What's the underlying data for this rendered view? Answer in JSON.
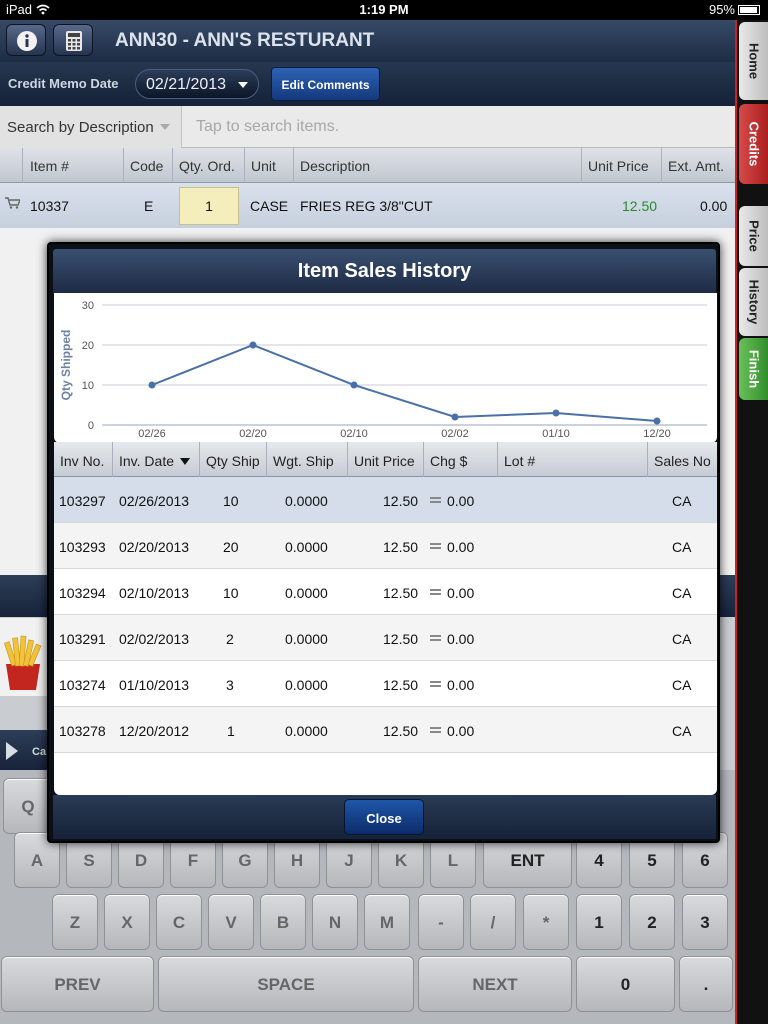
{
  "status_bar": {
    "carrier": "iPad",
    "time": "1:19 PM",
    "battery": "95%"
  },
  "header": {
    "title": "ANN30 - ANN'S RESTURANT",
    "info_icon": "info-icon",
    "calculator_icon": "calculator-icon"
  },
  "toolbar": {
    "memo_label": "Credit Memo Date",
    "memo_date": "02/21/2013",
    "edit_comments": "Edit Comments"
  },
  "search": {
    "mode": "Search by Description",
    "placeholder": "Tap to search items."
  },
  "order_columns": {
    "item": "Item #",
    "code": "Code",
    "qty": "Qty. Ord.",
    "unit": "Unit",
    "description": "Description",
    "unit_price": "Unit Price",
    "ext_amt": "Ext. Amt."
  },
  "order_row": {
    "item": "10337",
    "code": "E",
    "qty": "1",
    "unit": "CASE",
    "description": "FRIES REG 3/8\"CUT",
    "unit_price": "12.50",
    "ext_amt": "0.00",
    "price_color": "#2a8a2a"
  },
  "side_tabs": {
    "home": "Home",
    "credits": "Credits",
    "price": "Price",
    "history": "History",
    "finish": "Finish"
  },
  "partial_row_label": "Ca",
  "keyboard": {
    "row1": [
      "Q"
    ],
    "row2": [
      "A",
      "S",
      "D",
      "F",
      "G",
      "H",
      "J",
      "K",
      "L",
      "ENT",
      "4",
      "5",
      "6"
    ],
    "row3": [
      "Z",
      "X",
      "C",
      "V",
      "B",
      "N",
      "M",
      "-",
      "/",
      "*",
      "1",
      "2",
      "3"
    ],
    "row4": [
      "PREV",
      "SPACE",
      "NEXT",
      "0",
      "."
    ]
  },
  "modal": {
    "title": "Item Sales History",
    "columns": {
      "inv_no": "Inv No.",
      "inv_date": "Inv. Date",
      "qty_ship": "Qty Ship",
      "wgt_ship": "Wgt. Ship",
      "unit_price": "Unit Price",
      "chg": "Chg $",
      "lot": "Lot #",
      "sales_no": "Sales No"
    },
    "rows": [
      {
        "inv_no": "103297",
        "inv_date": "02/26/2013",
        "qty_ship": "10",
        "wgt_ship": "0.0000",
        "unit_price": "12.50",
        "chg": "0.00",
        "lot": "",
        "sales_no": "CA"
      },
      {
        "inv_no": "103293",
        "inv_date": "02/20/2013",
        "qty_ship": "20",
        "wgt_ship": "0.0000",
        "unit_price": "12.50",
        "chg": "0.00",
        "lot": "",
        "sales_no": "CA"
      },
      {
        "inv_no": "103294",
        "inv_date": "02/10/2013",
        "qty_ship": "10",
        "wgt_ship": "0.0000",
        "unit_price": "12.50",
        "chg": "0.00",
        "lot": "",
        "sales_no": "CA"
      },
      {
        "inv_no": "103291",
        "inv_date": "02/02/2013",
        "qty_ship": "2",
        "wgt_ship": "0.0000",
        "unit_price": "12.50",
        "chg": "0.00",
        "lot": "",
        "sales_no": "CA"
      },
      {
        "inv_no": "103274",
        "inv_date": "01/10/2013",
        "qty_ship": "3",
        "wgt_ship": "0.0000",
        "unit_price": "12.50",
        "chg": "0.00",
        "lot": "",
        "sales_no": "CA"
      },
      {
        "inv_no": "103278",
        "inv_date": "12/20/2012",
        "qty_ship": "1",
        "wgt_ship": "0.0000",
        "unit_price": "12.50",
        "chg": "0.00",
        "lot": "",
        "sales_no": "CA"
      }
    ],
    "close_label": "Close"
  },
  "chart_data": {
    "type": "line",
    "title": "",
    "xlabel": "",
    "ylabel": "Qty Shipped",
    "categories": [
      "02/26",
      "02/20",
      "02/10",
      "02/02",
      "01/10",
      "12/20"
    ],
    "series": [
      {
        "values": [
          10,
          20,
          10,
          2,
          3,
          1
        ]
      }
    ],
    "ylim": [
      0,
      30
    ],
    "yticks": [
      0,
      10,
      20,
      30
    ],
    "grid": true,
    "line_color": "#4a70a8"
  }
}
